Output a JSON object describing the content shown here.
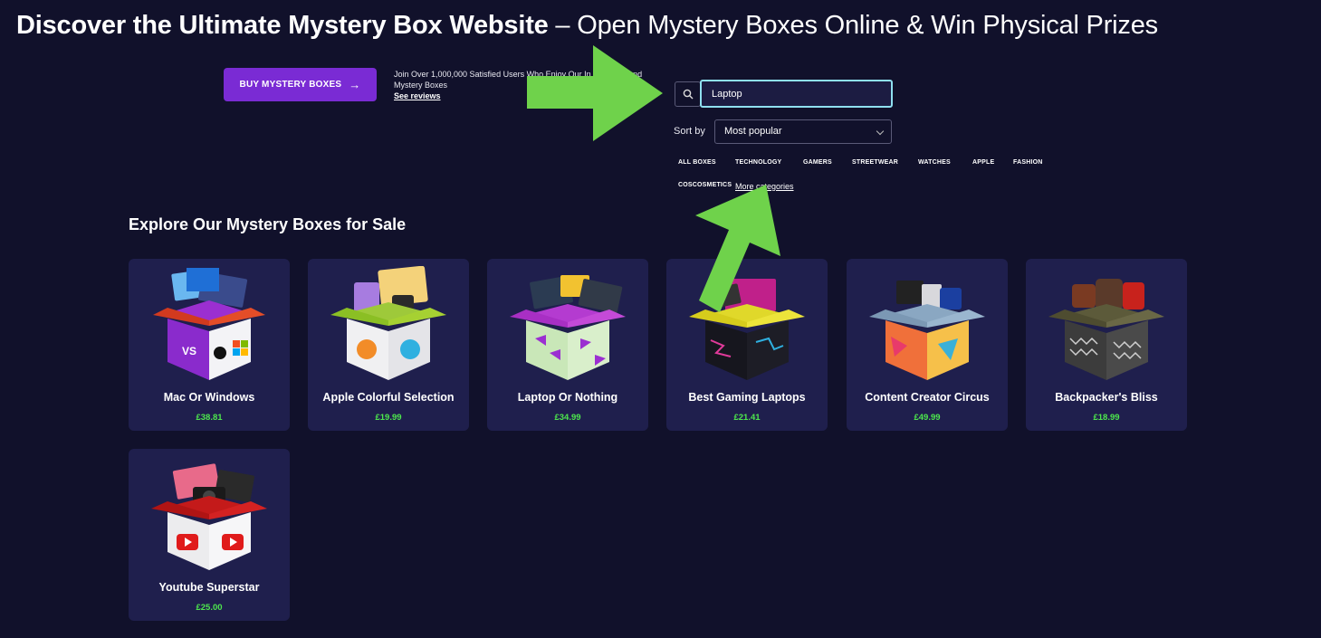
{
  "headline": {
    "bold": "Discover the Ultimate Mystery Box Website",
    "light": " – Open Mystery Boxes Online & Win Physical Prizes"
  },
  "buy_button": {
    "label": "BUY MYSTERY BOXES",
    "icon": "arrow-right-icon"
  },
  "promo": {
    "text": "Join Over 1,000,000 Satisfied Users Who Enjoy Our In... Games and Mystery Boxes",
    "reviews_link": "See reviews"
  },
  "search": {
    "icon": "search-icon",
    "value": "Laptop"
  },
  "sort": {
    "label": "Sort by",
    "selected": "Most popular",
    "icon": "chevron-down-icon"
  },
  "categories": [
    "ALL BOXES",
    "TECHNOLOGY",
    "GAMERS",
    "STREETWEAR",
    "WATCHES",
    "APPLE",
    "FASHION",
    "COSCOSMETICS"
  ],
  "more_categories": "More categories",
  "section_title": "Explore Our Mystery Boxes for Sale",
  "boxes": [
    {
      "name": "Mac Or Windows",
      "price": "£38.81"
    },
    {
      "name": "Apple Colorful Selection",
      "price": "£19.99"
    },
    {
      "name": "Laptop Or Nothing",
      "price": "£34.99"
    },
    {
      "name": "Best Gaming Laptops",
      "price": "£21.41"
    },
    {
      "name": "Content Creator Circus",
      "price": "£49.99"
    },
    {
      "name": "Backpacker's Bliss",
      "price": "£18.99"
    },
    {
      "name": "Youtube Superstar",
      "price": "£25.00"
    }
  ],
  "colors": {
    "background": "#11112b",
    "card": "#1f1f4d",
    "button": "#7a2bd4",
    "price": "#4de84d",
    "search_focus": "#8fe0f0",
    "annotation_arrow": "#6fd24b"
  }
}
